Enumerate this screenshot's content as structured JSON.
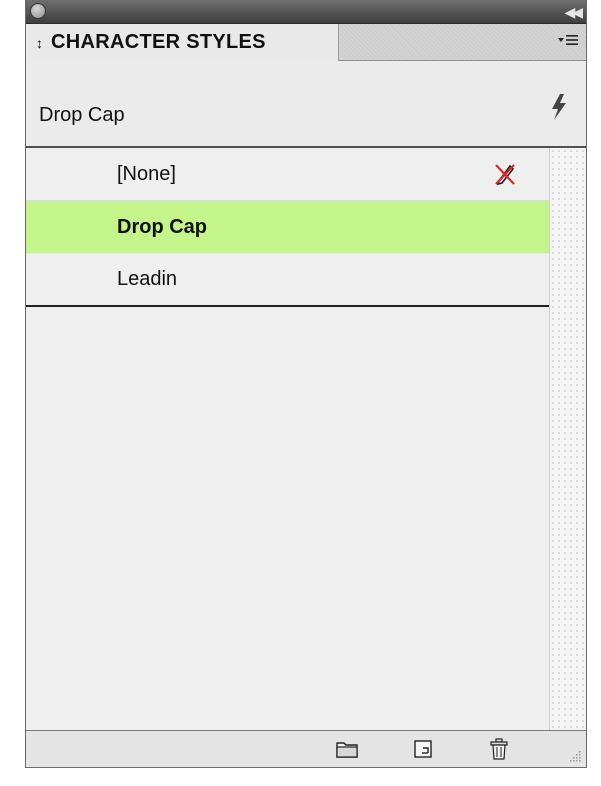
{
  "panel": {
    "tab_title": "CHARACTER STYLES",
    "tab_arrows": "↕",
    "current_style": "Drop Cap"
  },
  "styles": {
    "items": [
      {
        "label": "[None]"
      },
      {
        "label": "Drop Cap"
      },
      {
        "label": "Leadin"
      }
    ]
  },
  "icons": {
    "title_close": "close-circle-icon",
    "collapse": "double-chevron-left-icon",
    "panel_menu": "panel-menu-icon",
    "clear_overrides": "lightning-icon",
    "no_override": "crossed-pencil-icon",
    "new_group": "folder-icon",
    "new_style": "new-style-icon",
    "delete": "trash-icon",
    "resize": "resize-grip-icon"
  },
  "colors": {
    "selected_row": "#c4f58a",
    "no_override_cross": "#d9292a"
  }
}
